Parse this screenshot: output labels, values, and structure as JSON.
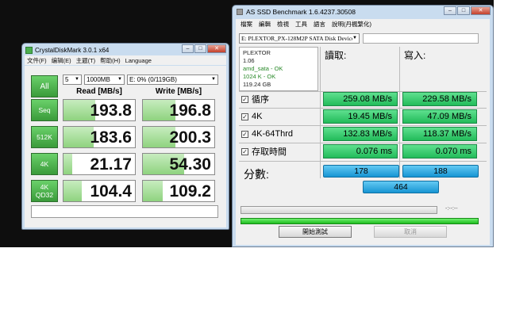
{
  "cdm": {
    "title": "CrystalDiskMark 3.0.1 x64",
    "menu": [
      "文件(F)",
      "编辑(E)",
      "主题(T)",
      "帮助(H)",
      "Language"
    ],
    "all_label": "All",
    "runs": "5",
    "size": "1000MB",
    "drive": "E: 0% (0/119GB)",
    "read_header": "Read [MB/s]",
    "write_header": "Write [MB/s]",
    "rows": [
      {
        "label": "Seq",
        "read": "193.8",
        "write": "196.8",
        "read_frac": 0.44,
        "write_frac": 0.45
      },
      {
        "label": "512K",
        "read": "183.6",
        "write": "200.3",
        "read_frac": 0.42,
        "write_frac": 0.46
      },
      {
        "label": "4K",
        "read": "21.17",
        "write": "54.30",
        "read_frac": 0.12,
        "write_frac": 0.58
      },
      {
        "label1": "4K",
        "label2": "QD32",
        "read": "104.4",
        "write": "109.2",
        "read_frac": 0.26,
        "write_frac": 0.28
      }
    ]
  },
  "asd": {
    "title": "AS SSD Benchmark 1.6.4237.30508",
    "menu": [
      "檔案",
      "編輯",
      "檢視",
      "工具",
      "語言",
      "說明(丹楓繁化)"
    ],
    "drive": "E: PLEXTOR_PX-128M2P SATA Disk Device",
    "info": {
      "model": "PLEXTOR",
      "fw": "1.06",
      "driver": "amd_sata - OK",
      "align": "1024 K - OK",
      "size": "119.24 GB"
    },
    "read_header": "讀取:",
    "write_header": "寫入:",
    "tests": [
      {
        "label": "循序",
        "read": "259.08 MB/s",
        "write": "229.58 MB/s"
      },
      {
        "label": "4K",
        "read": "19.45 MB/s",
        "write": "47.09 MB/s"
      },
      {
        "label": "4K-64Thrd",
        "read": "132.83 MB/s",
        "write": "118.37 MB/s"
      },
      {
        "label": "存取時間",
        "read": "0.076 ms",
        "write": "0.070 ms"
      }
    ],
    "score_label": "分數:",
    "score_read": "178",
    "score_write": "188",
    "score_total": "464",
    "time": "-:--:--",
    "progress_fill": 1.0,
    "start_button": "開始測試",
    "cancel_button": "取消"
  },
  "colors": {
    "accent_green": "#22bb5a",
    "score_blue": "#1795d3",
    "cdm_green": "#3a9b3a"
  }
}
